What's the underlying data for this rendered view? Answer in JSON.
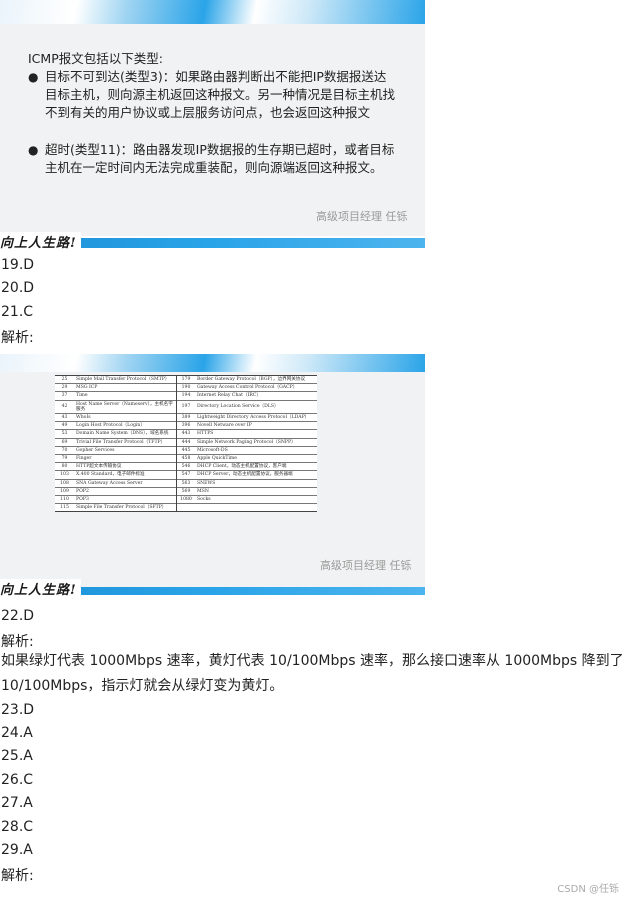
{
  "slide1": {
    "heading": "ICMP报文包括以下类型:",
    "bullets": [
      "目标不可到达(类型3)：如果路由器判断出不能把IP数据报送达目标主机，则向源主机返回这种报文。另一种情况是目标主机找不到有关的用户协议或上层服务访问点，也会返回这种报文",
      "超时(类型11)：路由器发现IP数据报的生存期已超时，或者目标主机在一定时间内无法完成重装配，则向源端返回这种报文。"
    ],
    "watermark": "高级项目经理 任铄",
    "motto": "向上人生路!"
  },
  "answers_a": [
    "19.D",
    "20.D",
    "21.C"
  ],
  "analysis_label_1": "解析:",
  "slide2": {
    "watermark": "高级项目经理 任铄",
    "motto": "向上人生路!",
    "rows": [
      {
        "n1": "25",
        "p1": "Simple Mail Transfer Protocol（SMTP）",
        "n2": "179",
        "p2": "Border Gateway Protocol（BGP），边界网关协议"
      },
      {
        "n1": "29",
        "p1": "MSG ICP",
        "n2": "190",
        "p2": "Gateway Access Control Protocol（GACP）"
      },
      {
        "n1": "37",
        "p1": "Time",
        "n2": "194",
        "p2": "Internet Relay Chat（IRC）"
      },
      {
        "n1": "42",
        "p1": "Host Name Server（Nameserv），主机名字服务",
        "n2": "197",
        "p2": "Directory Location Service（DLS）"
      },
      {
        "n1": "43",
        "p1": "WhoIs",
        "n2": "389",
        "p2": "Lightweight Directory Access Protocol（LDAP）"
      },
      {
        "n1": "49",
        "p1": "Login Host Protocol（Login）",
        "n2": "396",
        "p2": "Novell Netware over IP"
      },
      {
        "n1": "53",
        "p1": "Domain Name System（DNS），域名系统",
        "n2": "443",
        "p2": "HTTPS"
      },
      {
        "n1": "69",
        "p1": "Trivial File Transfer Protocol（TFTP）",
        "n2": "444",
        "p2": "Simple Network Paging Protocol（SNPP）"
      },
      {
        "n1": "70",
        "p1": "Gopher Services",
        "n2": "445",
        "p2": "Microsoft-DS"
      },
      {
        "n1": "79",
        "p1": "Finger",
        "n2": "458",
        "p2": "Apple QuickTime"
      },
      {
        "n1": "80",
        "p1": "HTTP超文本传输协议",
        "n2": "546",
        "p2": "DHCP Client，动态主机配置协议，客户端"
      },
      {
        "n1": "103",
        "p1": "X.400 Standard，电子邮件标准",
        "n2": "547",
        "p2": "DHCP Server，动态主机配置协议，服务器端"
      },
      {
        "n1": "108",
        "p1": "SNA Gateway Access Server",
        "n2": "563",
        "p2": "SNEWS"
      },
      {
        "n1": "109",
        "p1": "POP2",
        "n2": "569",
        "p2": "MSN"
      },
      {
        "n1": "110",
        "p1": "POP3",
        "n2": "1080",
        "p2": "Socks"
      },
      {
        "n1": "115",
        "p1": "Simple File Transfer Protocol（SFTP）",
        "n2": "",
        "p2": ""
      }
    ]
  },
  "answer_22": "22.D",
  "analysis_label_2": "解析:",
  "analysis_text_2": "如果绿灯代表 1000Mbps 速率，黄灯代表 10/100Mbps 速率，那么接口速率从 1000Mbps 降到了 10/100Mbps，指示灯就会从绿灯变为黄灯。",
  "answers_b": [
    "23.D",
    "24.A",
    "25.A",
    "26.C",
    "27.A",
    "28.C",
    "29.A"
  ],
  "analysis_label_3": "解析:",
  "footer": "CSDN @任铄"
}
